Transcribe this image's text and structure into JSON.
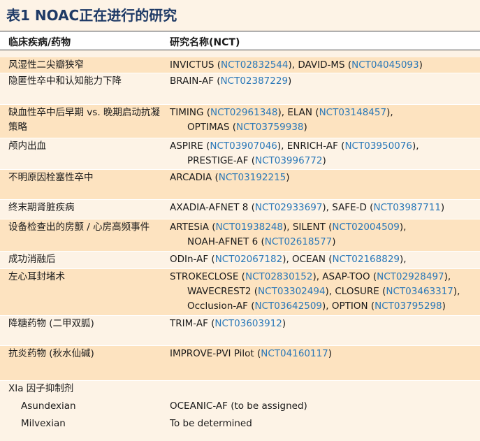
{
  "title": "表1 NOAC正在进行的研究",
  "headers": {
    "col1": "临床疾病/药物",
    "col2": "研究名称(NCT)"
  },
  "rows": [
    {
      "condition": "风湿性二尖瓣狭窄",
      "lines": [
        [
          {
            "t": "INVICTUS ("
          },
          {
            "t": "NCT02832544",
            "link": true
          },
          {
            "t": "), DAVID-MS ("
          },
          {
            "t": "NCT04045093",
            "link": true
          },
          {
            "t": ")"
          }
        ]
      ]
    },
    {
      "condition": "隐匿性卒中和认知能力下降",
      "lines": [
        [
          {
            "t": "BRAIN-AF ("
          },
          {
            "t": "NCT02387229",
            "link": true
          },
          {
            "t": ")"
          }
        ]
      ]
    },
    {
      "condition": "缺血性卒中后早期 vs. 晚期启动抗凝策略",
      "lines": [
        [
          {
            "t": "TIMING ("
          },
          {
            "t": "NCT02961348",
            "link": true
          },
          {
            "t": "), ELAN ("
          },
          {
            "t": "NCT03148457",
            "link": true
          },
          {
            "t": "),"
          }
        ],
        [
          {
            "t": "OPTIMAS ("
          },
          {
            "t": "NCT03759938",
            "link": true
          },
          {
            "t": ")"
          }
        ]
      ]
    },
    {
      "condition": "颅内出血",
      "lines": [
        [
          {
            "t": "ASPIRE ("
          },
          {
            "t": "NCT03907046",
            "link": true
          },
          {
            "t": "), ENRICH-AF ("
          },
          {
            "t": "NCT03950076",
            "link": true
          },
          {
            "t": "),"
          }
        ],
        [
          {
            "t": "PRESTIGE-AF ("
          },
          {
            "t": "NCT03996772",
            "link": true
          },
          {
            "t": ")"
          }
        ]
      ]
    },
    {
      "condition": "不明原因栓塞性卒中",
      "lines": [
        [
          {
            "t": "ARCADIA ("
          },
          {
            "t": "NCT03192215",
            "link": true
          },
          {
            "t": ")"
          }
        ]
      ]
    },
    {
      "condition": "终末期肾脏疾病",
      "lines": [
        [
          {
            "t": "AXADIA-AFNET 8 ("
          },
          {
            "t": "NCT02933697",
            "link": true
          },
          {
            "t": "), SAFE-D ("
          },
          {
            "t": "NCT03987711",
            "link": true
          },
          {
            "t": ")"
          }
        ]
      ]
    },
    {
      "condition": "设备检查出的房颤 / 心房高频事件",
      "lines": [
        [
          {
            "t": "ARTESiA ("
          },
          {
            "t": "NCT01938248",
            "link": true
          },
          {
            "t": "), SILENT ("
          },
          {
            "t": "NCT02004509",
            "link": true
          },
          {
            "t": "),"
          }
        ],
        [
          {
            "t": "NOAH-AFNET 6 ("
          },
          {
            "t": "NCT02618577",
            "link": true
          },
          {
            "t": ")"
          }
        ]
      ]
    },
    {
      "condition": "成功消融后",
      "lines": [
        [
          {
            "t": "ODIn-AF ("
          },
          {
            "t": "NCT02067182",
            "link": true
          },
          {
            "t": "), OCEAN ("
          },
          {
            "t": "NCT02168829",
            "link": true
          },
          {
            "t": "),"
          }
        ]
      ]
    },
    {
      "condition": "左心耳封堵术",
      "lines": [
        [
          {
            "t": "STROKECLOSE ("
          },
          {
            "t": "NCT02830152",
            "link": true
          },
          {
            "t": "), ASAP-TOO ("
          },
          {
            "t": "NCT02928497",
            "link": true
          },
          {
            "t": "),"
          }
        ],
        [
          {
            "t": "WAVECREST2 ("
          },
          {
            "t": "NCT03302494",
            "link": true
          },
          {
            "t": "), CLOSURE ("
          },
          {
            "t": "NCT03463317",
            "link": true
          },
          {
            "t": "),"
          }
        ],
        [
          {
            "t": "Occlusion-AF ("
          },
          {
            "t": "NCT03642509",
            "link": true
          },
          {
            "t": "), OPTION ("
          },
          {
            "t": "NCT03795298",
            "link": true
          },
          {
            "t": ")"
          }
        ]
      ]
    },
    {
      "condition": "降糖药物 (二甲双胍)",
      "lines": [
        [
          {
            "t": "TRIM-AF ("
          },
          {
            "t": "NCT03603912",
            "link": true
          },
          {
            "t": ")"
          }
        ]
      ]
    },
    {
      "condition": "抗炎药物 (秋水仙碱)",
      "lines": [
        [
          {
            "t": "IMPROVE-PVI Pilot ("
          },
          {
            "t": "NCT04160117",
            "link": true
          },
          {
            "t": ")"
          }
        ]
      ]
    },
    {
      "condition": "XIa 因子抑制剂",
      "lines": []
    },
    {
      "condition": "Asundexian",
      "lines": [
        [
          {
            "t": "OCEANIC-AF (to be assigned)"
          }
        ]
      ]
    },
    {
      "condition": "Milvexian",
      "lines": [
        [
          {
            "t": "To be determined"
          }
        ]
      ]
    }
  ]
}
